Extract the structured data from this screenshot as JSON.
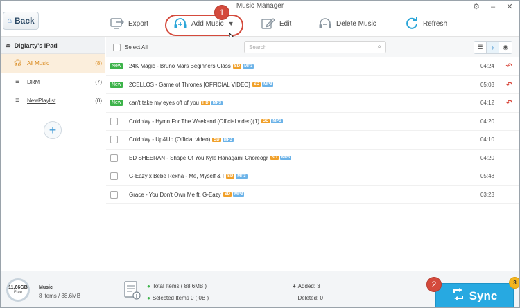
{
  "window": {
    "title": "Music Manager"
  },
  "colors": {
    "accent": "#27a9e1",
    "annotation": "#d44a3c",
    "active_item": "#d98a1f",
    "new_tag": "#3db34a",
    "undo": "#d8473b"
  },
  "toolbar": {
    "back_label": "Back",
    "export_label": "Export",
    "add_music_label": "Add Music",
    "edit_label": "Edit",
    "delete_label": "Delete Music",
    "refresh_label": "Refresh"
  },
  "annotations": {
    "step1": "1",
    "step2": "2"
  },
  "sidebar": {
    "device_name": "Digiarty's iPad",
    "items": [
      {
        "label": "All Music",
        "count": "(8)",
        "icon": "headphones-icon"
      },
      {
        "label": "DRM",
        "count": "(7)",
        "icon": "playlist-icon"
      },
      {
        "label": "NewPlaylist",
        "count": "(0)",
        "icon": "playlist-icon"
      }
    ]
  },
  "list": {
    "select_all_label": "Select All",
    "search_placeholder": "Search",
    "new_tag": "New",
    "rows": [
      {
        "title": "24K Magic - Bruno Mars   Beginners Class",
        "quality": "SD",
        "format": "MP3",
        "duration": "04:24",
        "is_new": true
      },
      {
        "title": "2CELLOS - Game of Thrones [OFFICIAL VIDEO]",
        "quality": "SD",
        "format": "MP3",
        "duration": "05:03",
        "is_new": true
      },
      {
        "title": "can't take my eyes off of you",
        "quality": "HD",
        "format": "MP3",
        "duration": "04:12",
        "is_new": true
      },
      {
        "title": "Coldplay - Hymn For The Weekend (Official video)(1)",
        "quality": "SD",
        "format": "MP3",
        "duration": "04:20",
        "is_new": false
      },
      {
        "title": "Coldplay - Up&Up (Official video)",
        "quality": "SD",
        "format": "MP3",
        "duration": "04:10",
        "is_new": false
      },
      {
        "title": "ED SHEERAN - Shape Of You   Kyle Hanagami Choreogr",
        "quality": "SD",
        "format": "MP3",
        "duration": "04:20",
        "is_new": false
      },
      {
        "title": "G-Eazy x Bebe Rexha - Me, Myself & I",
        "quality": "SD",
        "format": "MP3",
        "duration": "05:48",
        "is_new": false
      },
      {
        "title": "Grace - You Don't Own Me ft. G-Eazy",
        "quality": "SD",
        "format": "MP3",
        "duration": "03:23",
        "is_new": false
      }
    ]
  },
  "status": {
    "free_size": "11,66GB",
    "free_label": "Free",
    "category": "Music",
    "summary": "8 items / 88,6MB",
    "total_items": "Total Items  ( 88,6MB )",
    "selected_items": "Selected Items 0  ( 0B )",
    "added": "Added:  3",
    "deleted": "Deleted:  0"
  },
  "sync": {
    "label": "Sync",
    "badge": "3"
  }
}
